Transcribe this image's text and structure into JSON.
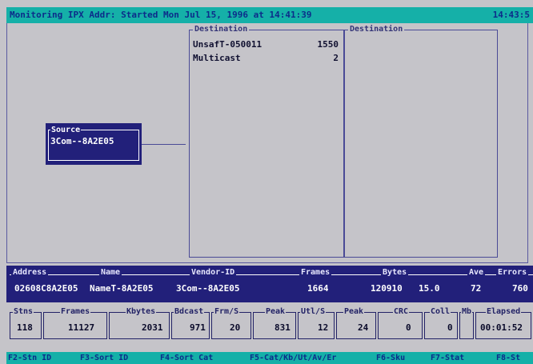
{
  "titlebar": {
    "title": "Monitoring IPX Addr: Started Mon Jul 15, 1996 at 14:41:39",
    "clock": "14:43:5"
  },
  "destinations": [
    {
      "label": "Destination",
      "rows": [
        {
          "name": "UnsafT-050011",
          "value": "1550"
        },
        {
          "name": "Multicast",
          "value": "2"
        }
      ]
    },
    {
      "label": "Destination",
      "rows": []
    }
  ],
  "source": {
    "label": "Source",
    "name": "3Com--8A2E05"
  },
  "address_table": {
    "headers": [
      "Address",
      "Name",
      "Vendor-ID",
      "Frames",
      "Bytes",
      "",
      "Ave",
      "Errors"
    ],
    "row": [
      "02608C8A2E05",
      "NameT-8A2E05",
      "3Com--8A2E05",
      "1664",
      "120910",
      "15.0",
      "72",
      "760"
    ]
  },
  "stats": [
    {
      "label": "Stns",
      "value": "118"
    },
    {
      "label": "Frames",
      "value": "11127"
    },
    {
      "label": "Kbytes",
      "value": "2031"
    },
    {
      "label": "Bdcast",
      "value": "971"
    },
    {
      "label": "Frm/S",
      "value": "20"
    },
    {
      "label": "Peak",
      "value": "831"
    },
    {
      "label": "Utl/S",
      "value": "12"
    },
    {
      "label": "Peak",
      "value": "24"
    },
    {
      "label": "CRC",
      "value": "0"
    },
    {
      "label": "Coll",
      "value": "0"
    },
    {
      "label": "Mb",
      "value": ""
    },
    {
      "label": "Elapsed",
      "value": "00:01:52"
    }
  ],
  "function_keys": [
    "F2-Stn ID",
    "F3-Sort ID",
    "F4-Sort Cat",
    "F5-Cat/Kb/Ut/Av/Er",
    "F6-Sku",
    "F7-Stat",
    "F8-St"
  ],
  "colors": {
    "title_bar": "#15b0a8",
    "panel_background": "#c5c4c9",
    "navy_stripe": "#22207a",
    "text_dark": "#0c2c8a"
  }
}
